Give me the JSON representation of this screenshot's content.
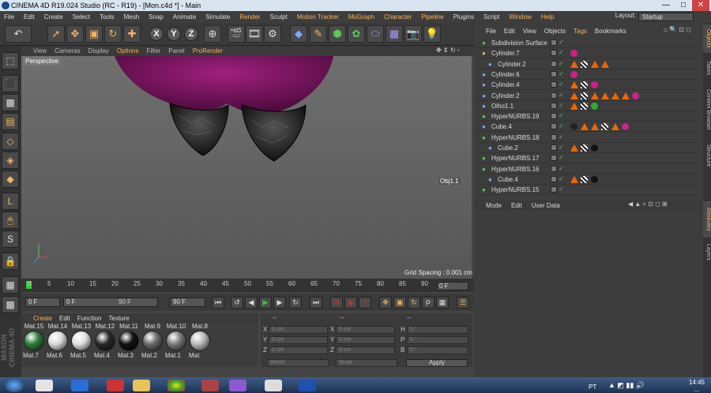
{
  "window": {
    "title": "CINEMA 4D R19.024 Studio (RC - R19) - [Mon.c4d *] - Main",
    "minimize": "—",
    "maximize": "□",
    "close": "✕"
  },
  "menu": [
    "File",
    "Edit",
    "Create",
    "Select",
    "Tools",
    "Mesh",
    "Snap",
    "Animate",
    "Simulate",
    "Render",
    "Sculpt",
    "Motion Tracker",
    "MoGraph",
    "Character",
    "Pipeline",
    "Plugins",
    "Script",
    "Window",
    "Help"
  ],
  "layout": {
    "label": "Layout:",
    "value": "Startup"
  },
  "toolbar": {
    "x": "X",
    "y": "Y",
    "z": "Z"
  },
  "viewport": {
    "menu": [
      "View",
      "Cameras",
      "Display",
      "Options",
      "Filter",
      "Panel",
      "ProRender"
    ],
    "label": "Perspective",
    "grid_spacing": "Grid Spacing : 0.001 cm",
    "obj_label": "Obj1.1"
  },
  "timeline": {
    "ticks": [
      "0",
      "5",
      "10",
      "15",
      "20",
      "25",
      "30",
      "35",
      "40",
      "45",
      "50",
      "55",
      "60",
      "65",
      "70",
      "75",
      "80",
      "85",
      "90"
    ],
    "frame": "0 F"
  },
  "transport": {
    "start": "0 F",
    "field2": "0 F",
    "field3": "90 F",
    "end": "90 F"
  },
  "materials": {
    "menu": [
      "Create",
      "Edit",
      "Function",
      "Texture"
    ],
    "top_labels": [
      "Mat.15",
      "Mat.14",
      "Mat.13",
      "Mat.12",
      "Mat.11",
      "Mat.9",
      "Mat.10",
      "Mat.8"
    ],
    "items": [
      {
        "label": "Mat.7",
        "color": "#2e7a3a"
      },
      {
        "label": "Mat.6",
        "color": "#d8d8d8"
      },
      {
        "label": "Mat.5",
        "color": "#e0e0e0"
      },
      {
        "label": "Mat.4",
        "color": "#2a2a2a"
      },
      {
        "label": "Mat.3",
        "color": "#111111"
      },
      {
        "label": "Mat.2",
        "color": "#6a6a6a"
      },
      {
        "label": "Mat.1",
        "color": "#7a7a7a"
      },
      {
        "label": "Mat",
        "color": "#bbbbbb"
      }
    ]
  },
  "coords": {
    "header": [
      "--",
      "--",
      "--"
    ],
    "rows": [
      {
        "a": "X",
        "av": "0 cm",
        "b": "X",
        "bv": "0 cm",
        "c": "H",
        "cv": "0 °"
      },
      {
        "a": "Y",
        "av": "0 cm",
        "b": "Y",
        "bv": "0 cm",
        "c": "P",
        "cv": "0 °"
      },
      {
        "a": "Z",
        "av": "0 cm",
        "b": "Z",
        "bv": "0 cm",
        "c": "B",
        "cv": "0 °"
      }
    ],
    "mode1": "World",
    "mode2": "Scale",
    "apply": "Apply"
  },
  "object_manager": {
    "menu": [
      "File",
      "Edit",
      "View",
      "Objects",
      "Tags",
      "Bookmarks"
    ],
    "objects": [
      {
        "name": "Subdivision Surface",
        "indent": 0,
        "color": "#5c5"
      },
      {
        "name": "Cylinder.7",
        "indent": 0,
        "color": "#f5b35c"
      },
      {
        "name": "Cylinder.2",
        "indent": 1,
        "color": "#7af"
      },
      {
        "name": "Cylinder.6",
        "indent": 0,
        "color": "#7af"
      },
      {
        "name": "Cylinder.4",
        "indent": 0,
        "color": "#7af"
      },
      {
        "name": "Cylinder.2",
        "indent": 0,
        "color": "#7af"
      },
      {
        "name": "Olho1.1",
        "indent": 0,
        "color": "#7af"
      },
      {
        "name": "HyperNURBS.19",
        "indent": 0,
        "color": "#5c5"
      },
      {
        "name": "Cube.4",
        "indent": 0,
        "color": "#7af"
      },
      {
        "name": "HyperNURBS.18",
        "indent": 0,
        "color": "#5c5"
      },
      {
        "name": "Cube.2",
        "indent": 1,
        "color": "#7af"
      },
      {
        "name": "HyperNURBS.17",
        "indent": 0,
        "color": "#5c5"
      },
      {
        "name": "HyperNURBS.16",
        "indent": 0,
        "color": "#5c5"
      },
      {
        "name": "Cube.4",
        "indent": 1,
        "color": "#7af"
      },
      {
        "name": "HyperNURBS.15",
        "indent": 0,
        "color": "#5c5"
      }
    ]
  },
  "attributes": {
    "menu": [
      "Mode",
      "Edit",
      "User Data"
    ]
  },
  "side_tabs": [
    "Objects",
    "Takes",
    "Content Browser",
    "Structure",
    "Attributes",
    "Layers"
  ],
  "taskbar": {
    "lang": "PT",
    "time": "14:45",
    "date": "..."
  }
}
